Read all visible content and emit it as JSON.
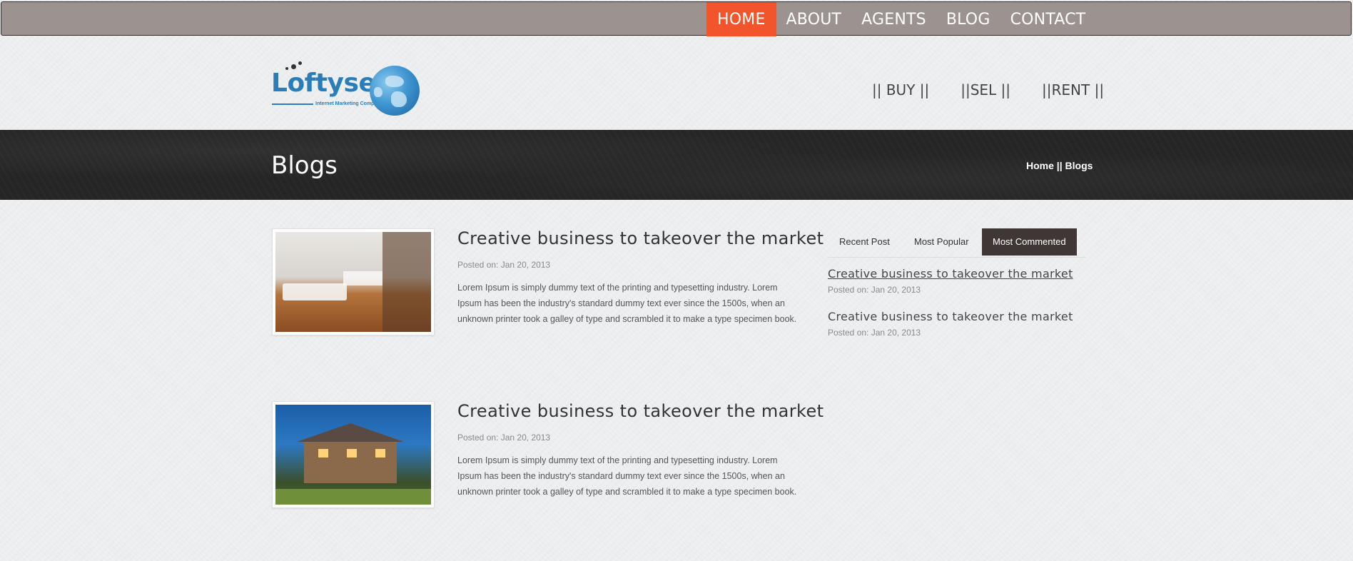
{
  "topnav": {
    "items": [
      {
        "label": "HOME",
        "active": true
      },
      {
        "label": "ABOUT",
        "active": false
      },
      {
        "label": "AGENTS",
        "active": false
      },
      {
        "label": "BLOG",
        "active": false
      },
      {
        "label": "CONTACT",
        "active": false
      }
    ],
    "active_color": "#f2552c",
    "bar_color": "#9c9390"
  },
  "logo": {
    "name": "Loftyserp",
    "tagline": "Internet Marketing Company",
    "brand_color": "#2b7db8"
  },
  "subnav": {
    "items": [
      "|| BUY ||",
      "||SEL ||",
      "||RENT ||"
    ]
  },
  "page_header": {
    "title": "Blogs",
    "breadcrumb_home": "Home",
    "breadcrumb_sep": " || ",
    "breadcrumb_current": "Blogs"
  },
  "posts": [
    {
      "title": "Creative business to takeover the market",
      "date": "Posted on: Jan 20, 2013",
      "excerpt": "Lorem Ipsum is simply dummy text of the printing and typesetting industry. Lorem Ipsum has been the industry's standard dummy text ever since the 1500s, when an unknown printer took a galley of type and scrambled it to make a type specimen book.",
      "image": "interior-photo"
    },
    {
      "title": "Creative business to takeover the market",
      "date": "Posted on: Jan 20, 2013",
      "excerpt": "Lorem Ipsum is simply dummy text of the printing and typesetting industry. Lorem Ipsum has been the industry's standard dummy text ever since the 1500s, when an unknown printer took a galley of type and scrambled it to make a type specimen book.",
      "image": "house-photo"
    }
  ],
  "sidebar": {
    "tabs": [
      {
        "label": "Recent Post",
        "active": false
      },
      {
        "label": "Most Popular",
        "active": false
      },
      {
        "label": "Most Commented",
        "active": true
      }
    ],
    "items": [
      {
        "title": "Creative business to takeover the market",
        "date": "Posted on: Jan 20, 2013"
      },
      {
        "title": "Creative business to takeover the market",
        "date": "Posted on: Jan 20, 2013"
      }
    ]
  }
}
